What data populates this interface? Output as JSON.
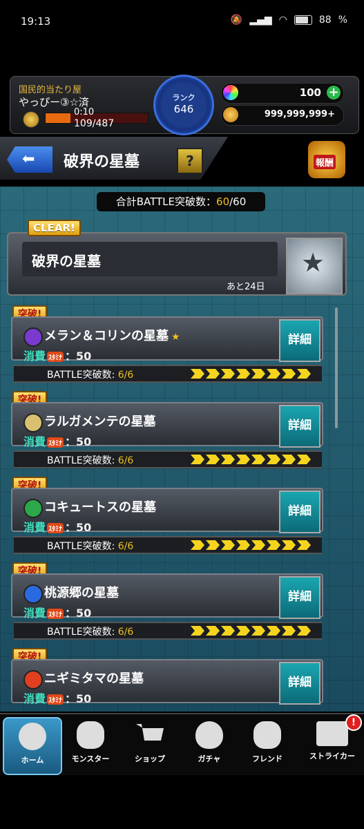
{
  "status_bar": {
    "time": "19:13",
    "battery": "88"
  },
  "player": {
    "title": "国民的当たり屋",
    "name": "やっぴー③☆済",
    "timer": "0:10",
    "exp": "109/487",
    "rank_label": "ランク",
    "rank_value": "646",
    "orbs": "100",
    "coins": "999,999,999+"
  },
  "quest_header": {
    "title": "破界の星墓",
    "help_label": "?",
    "reward_label": "報酬"
  },
  "total_clear": {
    "label": "合計BATTLE突破数：",
    "value": "60",
    "total": "/60"
  },
  "event": {
    "badge": "CLEAR!",
    "name": "破界の星墓",
    "remaining": "あと24日"
  },
  "quests": [
    {
      "badge": "突破!",
      "name": "メラン＆コリンの星墓",
      "star": "★",
      "cost_label": "消費",
      "stamina_label": "ｽﾀﾐﾅ",
      "cost": "：50",
      "detail_label": "詳細",
      "battle_label": "BATTLE突破数: ",
      "battle_value": "6/6",
      "icon_color": "#7a3ad0"
    },
    {
      "badge": "突破!",
      "name": "ラルガメンテの星墓",
      "star": "",
      "cost_label": "消費",
      "stamina_label": "ｽﾀﾐﾅ",
      "cost": "：50",
      "detail_label": "詳細",
      "battle_label": "BATTLE突破数: ",
      "battle_value": "6/6",
      "icon_color": "#d8c070"
    },
    {
      "badge": "突破!",
      "name": "コキュートスの星墓",
      "star": "",
      "cost_label": "消費",
      "stamina_label": "ｽﾀﾐﾅ",
      "cost": "：50",
      "detail_label": "詳細",
      "battle_label": "BATTLE突破数: ",
      "battle_value": "6/6",
      "icon_color": "#2aa84a"
    },
    {
      "badge": "突破!",
      "name": "桃源郷の星墓",
      "star": "",
      "cost_label": "消費",
      "stamina_label": "ｽﾀﾐﾅ",
      "cost": "：50",
      "detail_label": "詳細",
      "battle_label": "BATTLE突破数: ",
      "battle_value": "6/6",
      "icon_color": "#2a6ae0"
    },
    {
      "badge": "突破!",
      "name": "ニギミタマの星墓",
      "star": "",
      "cost_label": "消費",
      "stamina_label": "ｽﾀﾐﾅ",
      "cost": "：50",
      "detail_label": "詳細",
      "battle_label": "",
      "battle_value": "",
      "icon_color": "#e04020"
    }
  ],
  "nav": [
    {
      "label": "ホーム",
      "icon": "home-icon"
    },
    {
      "label": "モンスター",
      "icon": "monster-icon"
    },
    {
      "label": "ショップ",
      "icon": "cart-icon"
    },
    {
      "label": "ガチャ",
      "icon": "egg-icon"
    },
    {
      "label": "フレンド",
      "icon": "friend-icon"
    },
    {
      "label": "ストライカー",
      "icon": "striker-icon"
    }
  ],
  "nav_badge": "!"
}
